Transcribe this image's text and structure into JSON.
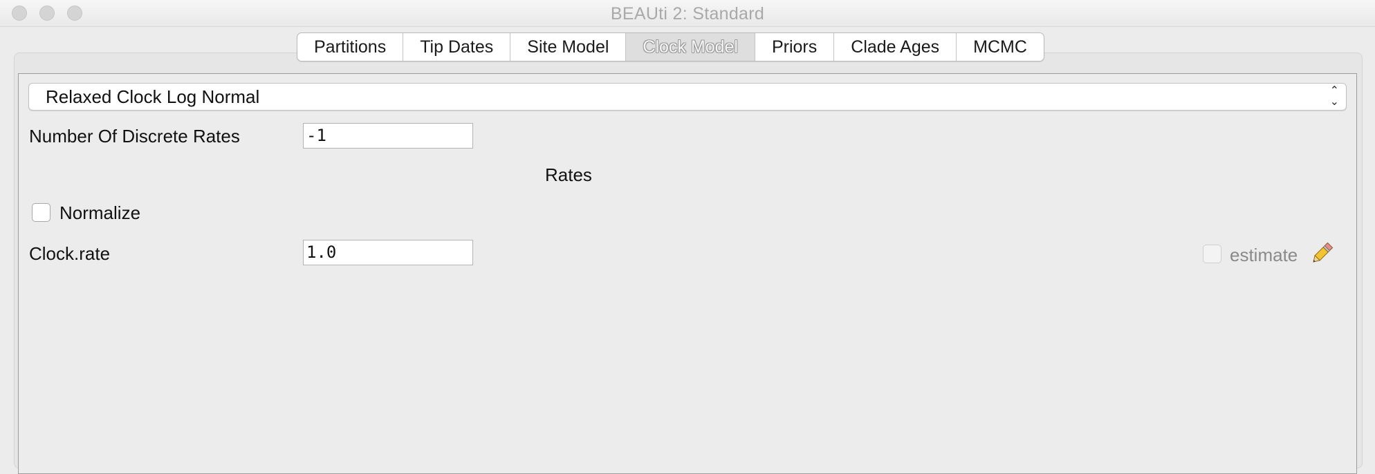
{
  "window": {
    "title": "BEAUti 2: Standard"
  },
  "tabs": [
    {
      "label": "Partitions"
    },
    {
      "label": "Tip Dates"
    },
    {
      "label": "Site Model"
    },
    {
      "label": "Clock Model",
      "selected": true
    },
    {
      "label": "Priors"
    },
    {
      "label": "Clade Ages"
    },
    {
      "label": "MCMC"
    }
  ],
  "clock_model": {
    "selected": "Relaxed Clock Log Normal",
    "discrete_rates_label": "Number Of Discrete Rates",
    "discrete_rates_value": "-1",
    "rates_heading": "Rates",
    "normalize_label": "Normalize",
    "normalize_checked": false,
    "clock_rate_label": "Clock.rate",
    "clock_rate_value": "1.0",
    "estimate_label": "estimate",
    "estimate_checked": false
  },
  "icons": {
    "edit": "pencil-icon"
  },
  "colors": {
    "panel_bg": "#ececec",
    "disabled_text": "#8a8a8a"
  }
}
